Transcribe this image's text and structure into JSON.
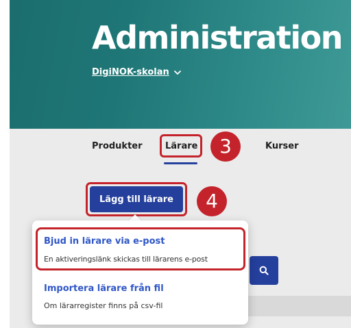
{
  "header": {
    "title": "Administration",
    "school_name": "DigiNOK-skolan",
    "school_chevron_icon": "chevron-down-icon"
  },
  "tabs": [
    {
      "label": "Produkter",
      "active": false
    },
    {
      "label": "Lärare",
      "active": true
    },
    {
      "label": "",
      "active": false
    },
    {
      "label": "Kurser",
      "active": false
    }
  ],
  "actions": {
    "add_teacher_label": "Lägg till lärare",
    "search_icon": "search-icon"
  },
  "dropdown": {
    "items": [
      {
        "title": "Bjud in lärare via e-post",
        "description": "En aktiveringslänk skickas till lärarens e-post"
      },
      {
        "title": "Importera lärare från fil",
        "description": "Om lärarregister finns på csv-fil"
      }
    ]
  },
  "annotations": {
    "step_tabs": "3",
    "step_button": "4"
  },
  "colors": {
    "header_teal": "#1f7676",
    "primary_blue": "#243f9c",
    "link_blue": "#2f56c6",
    "callout_red": "#c4232b",
    "panel_gray": "#ebebeb"
  }
}
